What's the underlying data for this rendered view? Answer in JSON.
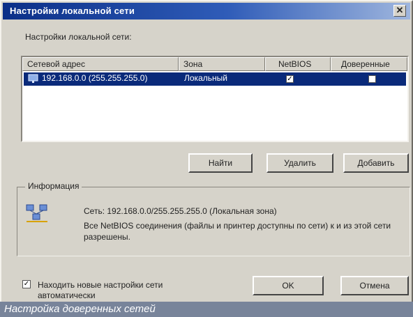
{
  "window": {
    "title": "Настройки локальной сети",
    "close_glyph": "✕"
  },
  "section_label": "Настройки локальной сети:",
  "columns": [
    "Сетевой адрес",
    "Зона",
    "NetBIOS",
    "Доверенные"
  ],
  "rows": [
    {
      "address": "192.168.0.0 (255.255.255.0)",
      "zone": "Локальный",
      "netbios": true,
      "trusted": false
    }
  ],
  "buttons": {
    "find": "Найти",
    "delete": "Удалить",
    "add": "Добавить",
    "ok": "OK",
    "cancel": "Отмена"
  },
  "info": {
    "legend": "Информация",
    "line1": "Сеть: 192.168.0.0/255.255.255.0 (Локальная зона)",
    "line2": "Все NetBIOS соединения (файлы и принтер доступны по сети) к и из этой сети разрешены."
  },
  "autodetect": {
    "checked": true,
    "label": "Находить новые настройки сети автоматически"
  },
  "caption": "Настройка доверенных сетей",
  "colors": {
    "title_start": "#0b2f88",
    "selection": "#0a2a7a",
    "caption_bg": "#78849a"
  }
}
